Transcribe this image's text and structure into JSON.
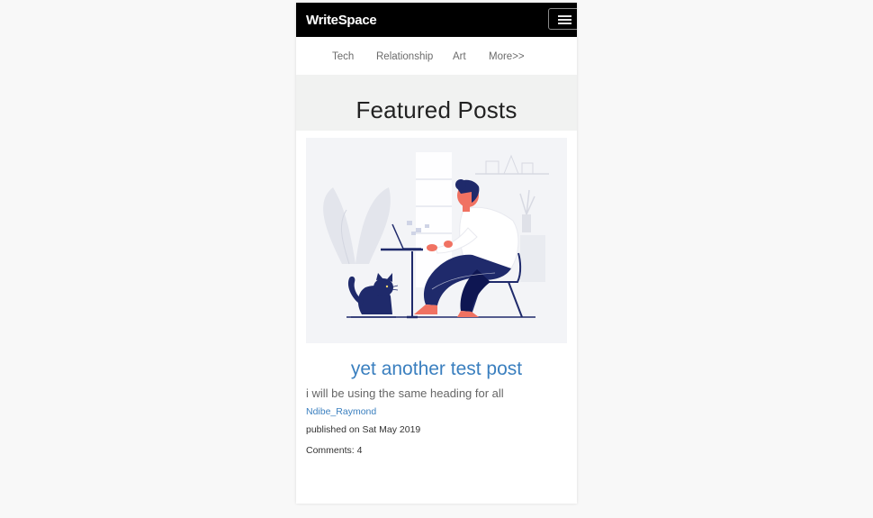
{
  "navbar": {
    "brand": "WriteSpace",
    "menu_icon": "hamburger-menu-icon"
  },
  "categories": {
    "items": [
      {
        "label": "Tech"
      },
      {
        "label": "Relationship"
      },
      {
        "label": "Art"
      },
      {
        "label": "More>>"
      }
    ]
  },
  "featured": {
    "title": "Featured Posts"
  },
  "post": {
    "image": "person-working-on-laptop-with-cat-illustration",
    "title": "yet another test post",
    "excerpt": "i will be using the same heading for all",
    "author": "Ndibe_Raymond",
    "published": "published on Sat May 2019",
    "comments": "Comments: 4"
  },
  "colors": {
    "navbar_bg": "#000000",
    "link_blue": "#3a7fbf",
    "band_bg": "#f1f2f1",
    "illustration_navy": "#1f2a6b",
    "illustration_coral": "#f07262"
  }
}
